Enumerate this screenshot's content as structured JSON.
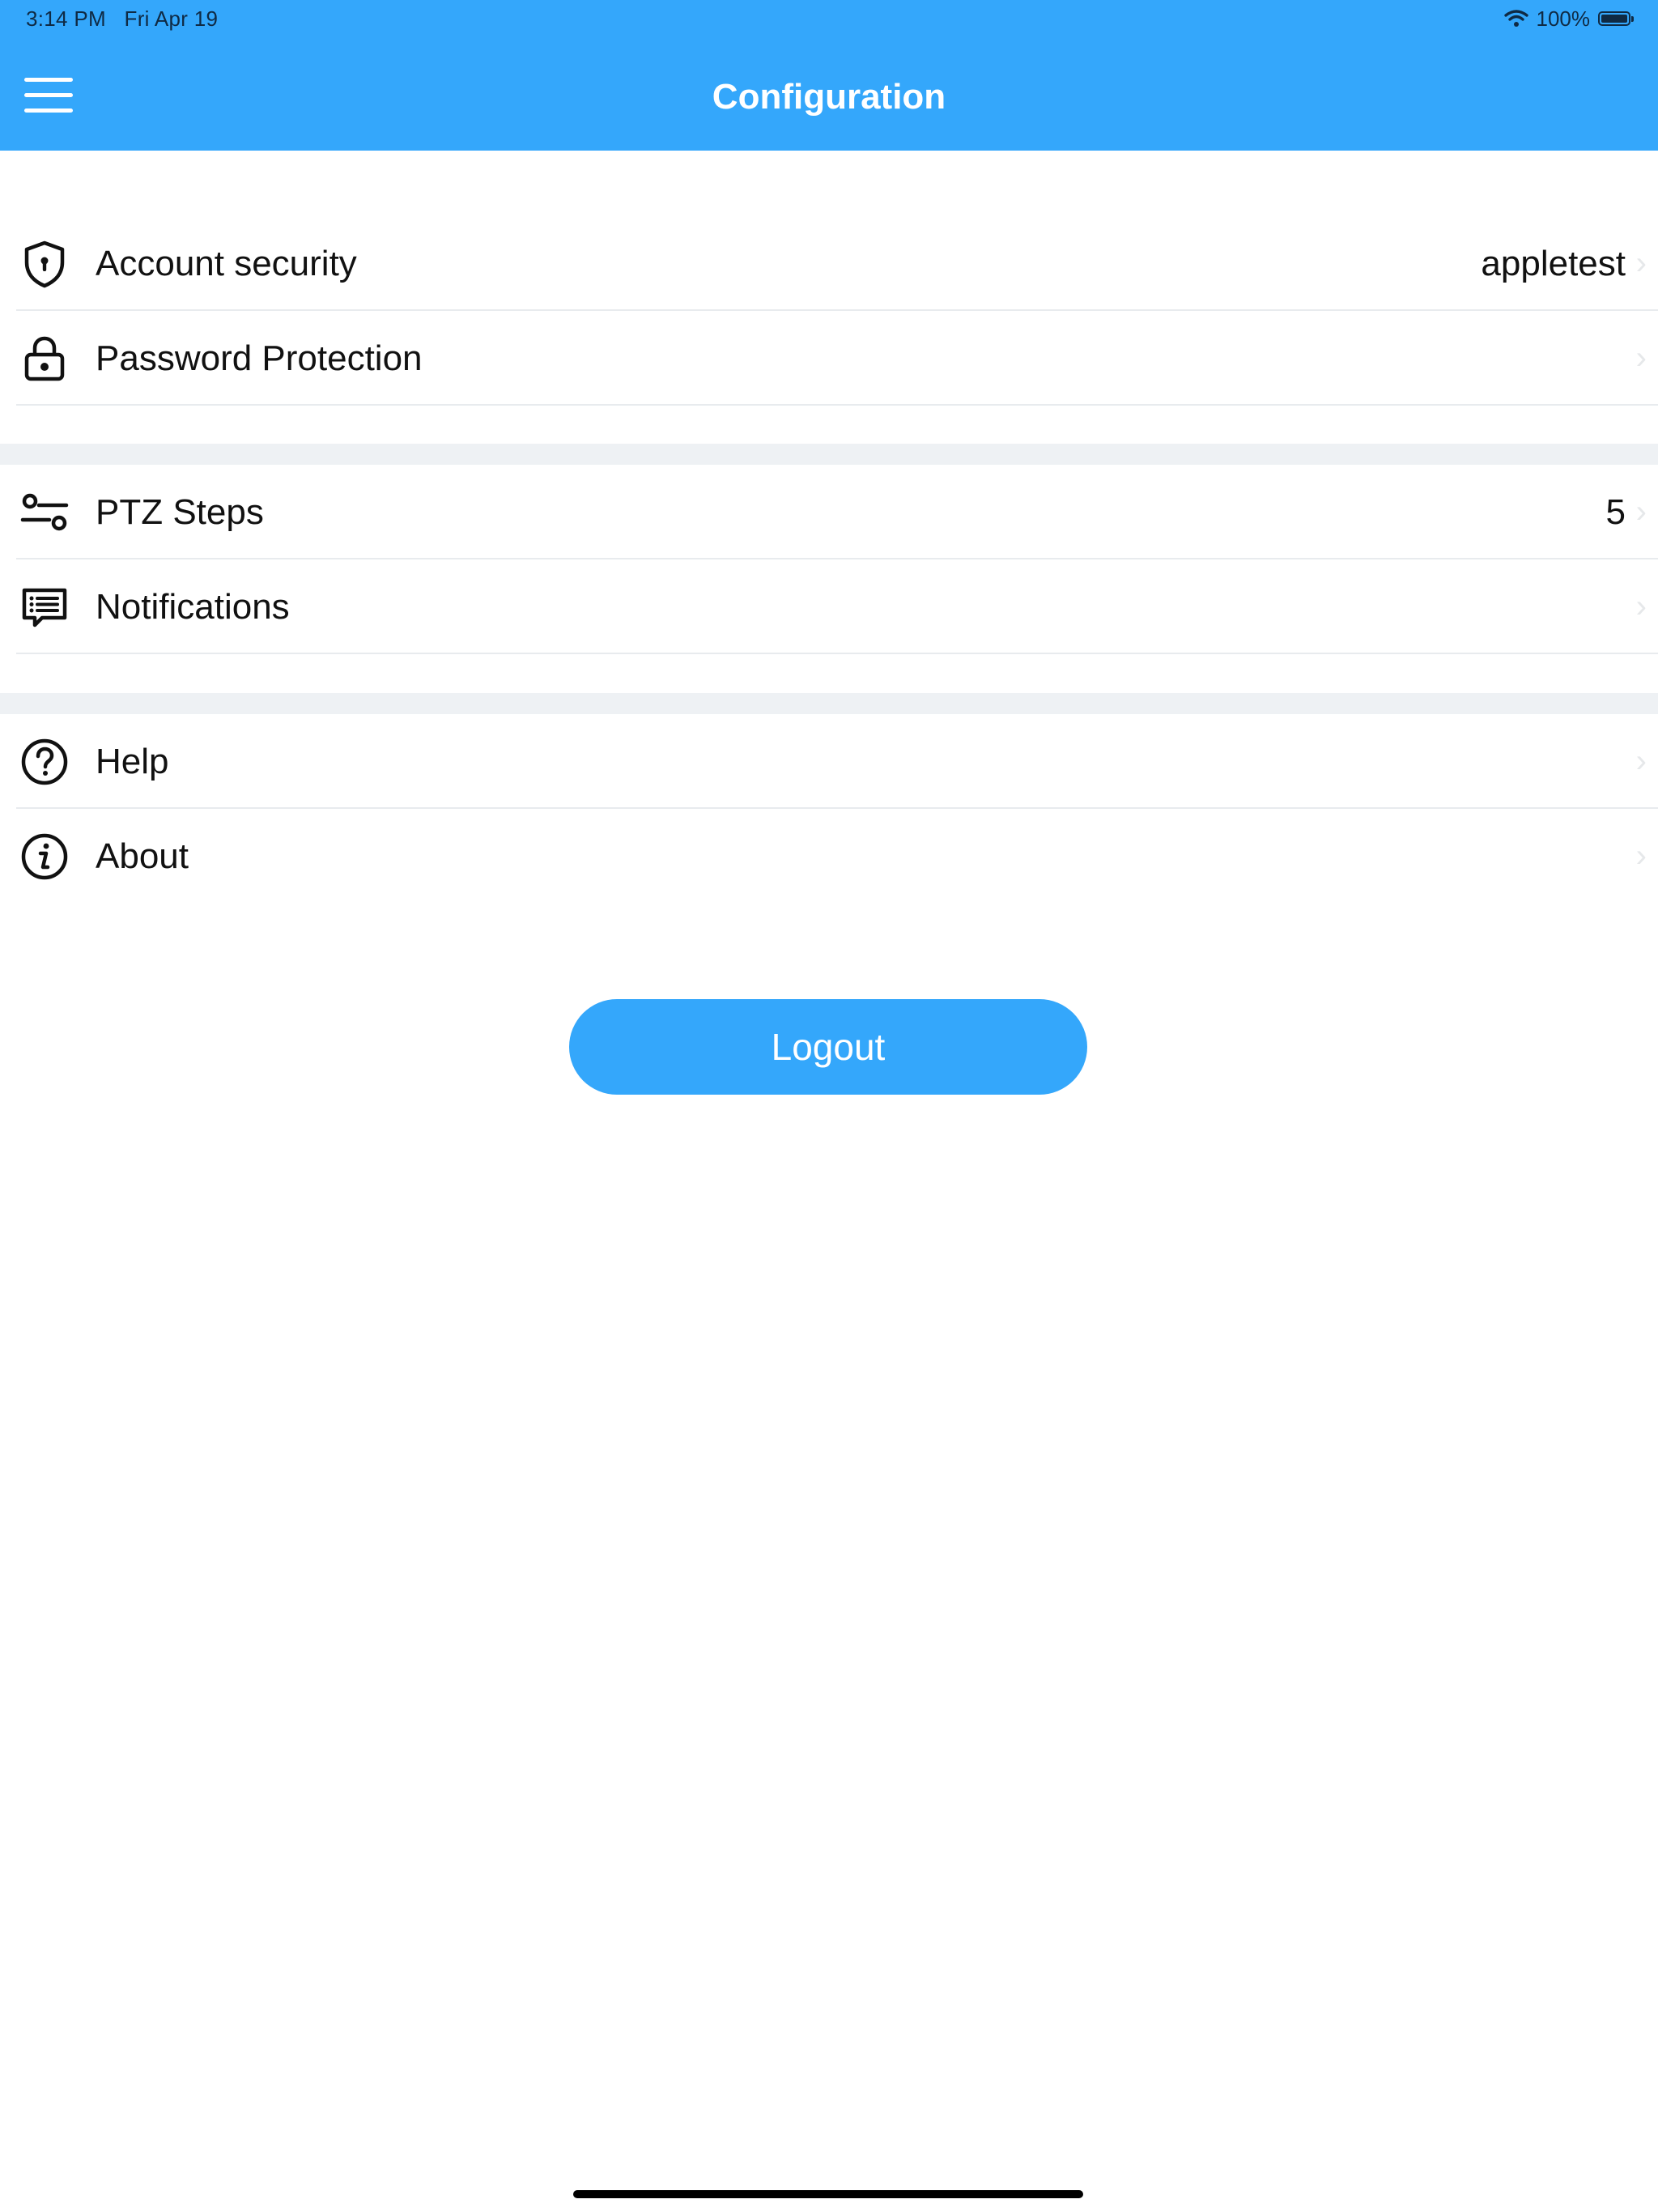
{
  "status_bar": {
    "time": "3:14 PM",
    "date": "Fri Apr 19",
    "battery": "100%"
  },
  "nav": {
    "title": "Configuration",
    "menu_icon": "hamburger-menu-icon"
  },
  "groups": [
    {
      "items": [
        {
          "icon": "shield-icon",
          "label": "Account security",
          "value": "appletest"
        },
        {
          "icon": "lock-icon",
          "label": "Password Protection",
          "value": ""
        }
      ]
    },
    {
      "items": [
        {
          "icon": "sliders-icon",
          "label": "PTZ Steps",
          "value": "5"
        },
        {
          "icon": "message-icon",
          "label": "Notifications",
          "value": ""
        }
      ]
    },
    {
      "items": [
        {
          "icon": "question-circle-icon",
          "label": "Help",
          "value": ""
        },
        {
          "icon": "info-circle-icon",
          "label": "About",
          "value": ""
        }
      ]
    }
  ],
  "chevron": "›",
  "logout_label": "Logout",
  "colors": {
    "accent": "#34a7fb",
    "separator": "#e8ebee",
    "section_gap": "#eef1f4"
  }
}
